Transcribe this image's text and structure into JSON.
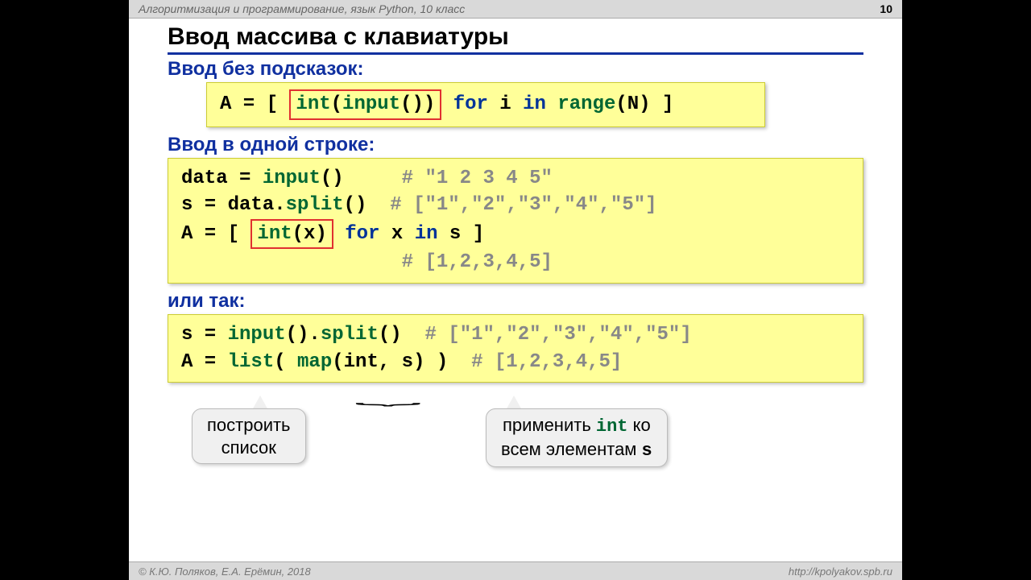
{
  "topbar": {
    "course": "Алгоритмизация и программирование, язык Python, 10 класс",
    "page": "10"
  },
  "title": "Ввод массива с клавиатуры",
  "section1": {
    "heading": "Ввод без подсказок:",
    "code": {
      "p1": "A = [ ",
      "box_fn1": "int",
      "box_p2": "(",
      "box_fn2": "input",
      "box_p3": "())",
      "p4": " ",
      "kw_for": "for",
      "p5": " i ",
      "kw_in": "in",
      "p6": " ",
      "fn_range": "range",
      "p7": "(N) ]"
    }
  },
  "section2": {
    "heading": "Ввод в одной строке:",
    "line1": {
      "a": "data = ",
      "fn": "input",
      "b": "()",
      "sp": "     ",
      "cm": "# \"1 2 3 4 5\""
    },
    "line2": {
      "a": "s = data.",
      "fn": "split",
      "b": "()",
      "sp": "  ",
      "cm": "# [\"1\",\"2\",\"3\",\"4\",\"5\"]"
    },
    "line3": {
      "a": "A = [ ",
      "box_fn": "int",
      "box_b": "(x)",
      "c": " ",
      "kw_for": "for",
      "d": " x ",
      "kw_in": "in",
      "e": " s ]"
    },
    "line4": {
      "sp": "                   ",
      "cm": "# [1,2,3,4,5]"
    }
  },
  "section3": {
    "heading": "или так:",
    "line1": {
      "a": "s = ",
      "fn1": "input",
      "b": "().",
      "fn2": "split",
      "c": "()",
      "sp": "  ",
      "cm": "# [\"1\",\"2\",\"3\",\"4\",\"5\"]"
    },
    "line2": {
      "a": "A = ",
      "fn1": "list",
      "b": "( ",
      "fn2": "map",
      "c": "(int, s) )",
      "sp": "  ",
      "cm": "# [1,2,3,4,5]"
    }
  },
  "callouts": {
    "left": "построить\nсписок",
    "right_a": "применить ",
    "right_fn": "int",
    "right_b": " ко",
    "right_c": "всем элементам ",
    "right_fn2": "s"
  },
  "footer": {
    "left": "© К.Ю. Поляков, Е.А. Ерёмин, 2018",
    "right": "http://kpolyakov.spb.ru"
  }
}
